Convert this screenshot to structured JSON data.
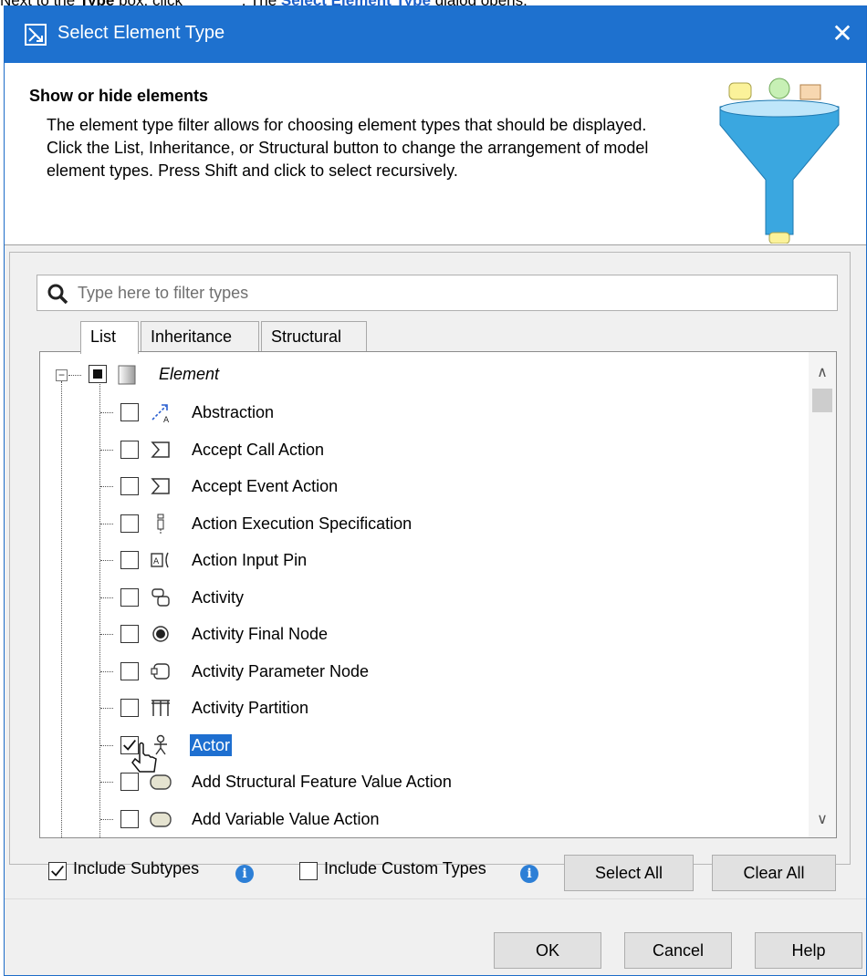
{
  "caption": {
    "prefix": "Next to the ",
    "bold1": "Type",
    "middle": " box, click ",
    "after_icon": ". The ",
    "link": "Select Element Type",
    "suffix": " dialog opens."
  },
  "window": {
    "title": "Select Element Type",
    "close_label": "✕"
  },
  "header": {
    "title": "Show or hide elements",
    "description": "The element type filter allows for choosing element types that should be displayed. Click the List, Inheritance, or Structural button to change the arrangement of model element types. Press Shift and click to select recursively."
  },
  "search": {
    "placeholder": "Type here to filter types",
    "value": ""
  },
  "tabs": [
    {
      "label": "List",
      "active": true
    },
    {
      "label": "Inheritance",
      "active": false
    },
    {
      "label": "Structural",
      "active": false
    }
  ],
  "tree": {
    "root": {
      "label": "Element",
      "expander": "−",
      "state": "partial"
    },
    "items": [
      {
        "label": "Abstraction",
        "icon": "abstraction-icon",
        "checked": false
      },
      {
        "label": "Accept Call Action",
        "icon": "accept-call-action-icon",
        "checked": false
      },
      {
        "label": "Accept Event Action",
        "icon": "accept-event-action-icon",
        "checked": false
      },
      {
        "label": "Action Execution Specification",
        "icon": "action-execution-specification-icon",
        "checked": false
      },
      {
        "label": "Action Input Pin",
        "icon": "action-input-pin-icon",
        "checked": false
      },
      {
        "label": "Activity",
        "icon": "activity-icon",
        "checked": false
      },
      {
        "label": "Activity Final Node",
        "icon": "activity-final-node-icon",
        "checked": false
      },
      {
        "label": "Activity Parameter Node",
        "icon": "activity-parameter-node-icon",
        "checked": false
      },
      {
        "label": "Activity Partition",
        "icon": "activity-partition-icon",
        "checked": false
      },
      {
        "label": "Actor",
        "icon": "actor-icon",
        "checked": true,
        "selected": true
      },
      {
        "label": "Add Structural Feature Value Action",
        "icon": "add-structural-feature-value-action-icon",
        "checked": false
      },
      {
        "label": "Add Variable Value Action",
        "icon": "add-variable-value-action-icon",
        "checked": false
      }
    ]
  },
  "options": {
    "include_subtypes": {
      "label": "Include Subtypes",
      "checked": true
    },
    "include_custom_types": {
      "label": "Include Custom Types",
      "checked": false
    }
  },
  "buttons": {
    "select_all": "Select All",
    "clear_all": "Clear All",
    "ok": "OK",
    "cancel": "Cancel",
    "help": "Help"
  },
  "colors": {
    "titlebar": "#1e71cf",
    "selection": "#1e6fd0",
    "info": "#2d7fd6"
  }
}
